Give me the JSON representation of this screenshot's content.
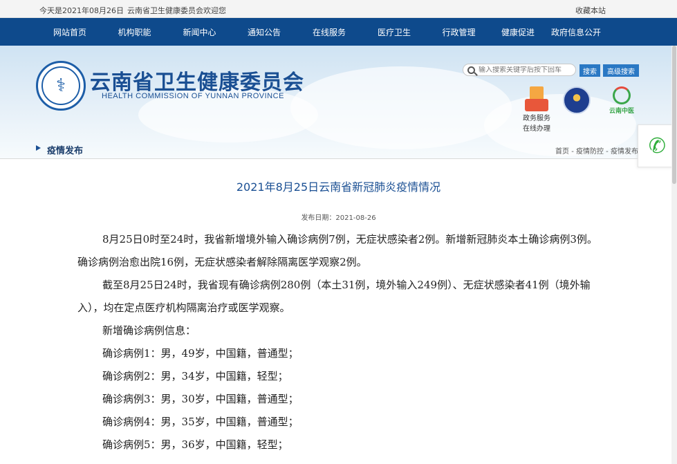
{
  "topbar": {
    "date": "今天是2021年08月26日",
    "welcome": "云南省卫生健康委员会欢迎您",
    "favorite": "收藏本站"
  },
  "nav": {
    "items": [
      "网站首页",
      "机构职能",
      "新闻中心",
      "通知公告",
      "在线服务",
      "医疗卫生",
      "行政管理",
      "健康促进",
      "政府信息公开"
    ]
  },
  "header": {
    "title": "云南省卫生健康委员会",
    "subtitle": "HEALTH COMMISSION OF YUNNAN PROVINCE",
    "search_placeholder": "输入搜索关键字后按下回车",
    "search_button": "搜索",
    "advanced_search_button": "高级搜索",
    "gov_service_label_1": "政务服务",
    "gov_service_label_2": "在线办理",
    "yntcm_label": "云南中医"
  },
  "section": {
    "title": "疫情发布",
    "breadcrumb": [
      "首页",
      "疫情防控",
      "疫情发布"
    ]
  },
  "article": {
    "title": "2021年8月25日云南省新冠肺炎疫情情况",
    "pub_date": "发布日期：2021-08-26",
    "paragraphs": [
      "8月25日0时至24时，我省新增境外输入确诊病例7例，无症状感染者2例。新增新冠肺炎本土确诊病例3例。确诊病例治愈出院16例，无症状感染者解除隔离医学观察2例。",
      "截至8月25日24时，我省现有确诊病例280例（本土31例，境外输入249例）、无症状感染者41例（境外输入），均在定点医疗机构隔离治疗或医学观察。",
      "新增确诊病例信息：",
      "确诊病例1：男，49岁，中国籍，普通型；",
      "确诊病例2：男，34岁，中国籍，轻型；",
      "确诊病例3：男，30岁，中国籍，普通型；",
      "确诊病例4：男，35岁，中国籍，普通型；",
      "确诊病例5：男，36岁，中国籍，轻型；"
    ]
  },
  "colors": {
    "nav_bg": "#0e4a8c",
    "brand_blue": "#1a4f93",
    "button_blue": "#2a78c4",
    "phone_green": "#2fae3b"
  },
  "icons": {
    "search": "search-icon",
    "phone": "phone-icon",
    "gov_service": "gov-service-icon",
    "logo": "commission-logo-icon"
  }
}
